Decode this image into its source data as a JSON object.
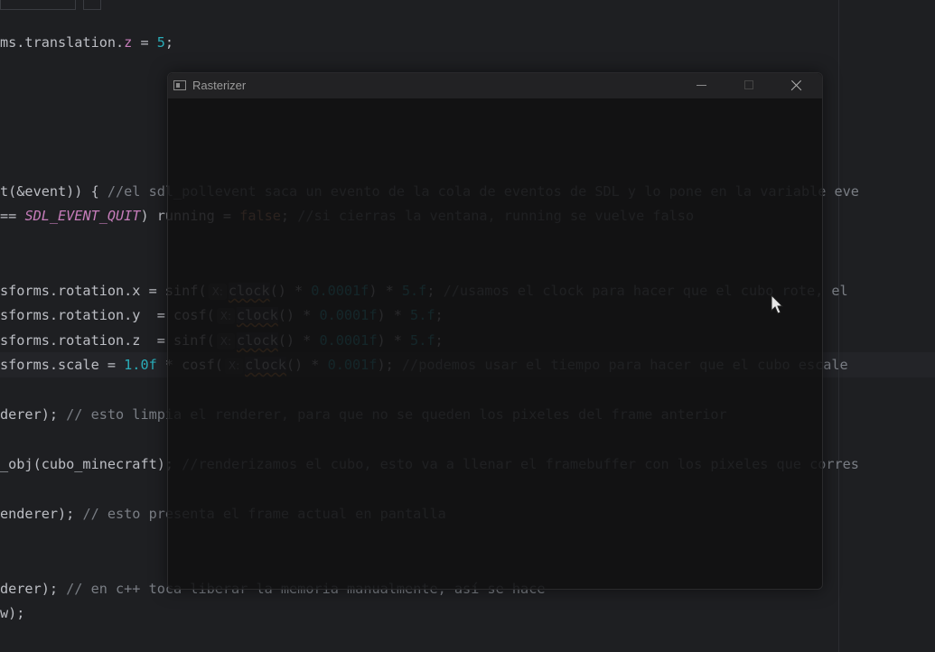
{
  "window": {
    "title": "Rasterizer"
  },
  "editor": {
    "lines": [
      {
        "segments": [
          {
            "t": "ms.translation.",
            "c": "plain"
          },
          {
            "t": "z",
            "c": "field"
          },
          {
            "t": " = ",
            "c": "plain"
          },
          {
            "t": "5",
            "c": "num"
          },
          {
            "t": ";",
            "c": "plain"
          }
        ]
      },
      {
        "segments": [
          {
            "t": "t(&event)) { ",
            "c": "plain"
          },
          {
            "t": "//el sdl_pollevent saca un evento de la cola de eventos de SDL y lo pone en la variable eve",
            "c": "com"
          }
        ]
      },
      {
        "segments": [
          {
            "t": "== ",
            "c": "plain"
          },
          {
            "t": "SDL_EVENT_QUIT",
            "c": "const"
          },
          {
            "t": ") running = ",
            "c": "plain"
          },
          {
            "t": "false",
            "c": "kw"
          },
          {
            "t": "; ",
            "c": "plain"
          },
          {
            "t": "//si cierras la ventana, running se vuelve falso",
            "c": "com"
          }
        ]
      },
      {
        "segments": [
          {
            "t": "sforms.rotation.x = sinf(",
            "c": "plain"
          },
          {
            "t": "X:",
            "c": "hint"
          },
          {
            "t": "clock",
            "c": "clock"
          },
          {
            "t": "() * ",
            "c": "plain"
          },
          {
            "t": "0.0001f",
            "c": "num"
          },
          {
            "t": ") * ",
            "c": "plain"
          },
          {
            "t": "5.f",
            "c": "num"
          },
          {
            "t": "; ",
            "c": "plain"
          },
          {
            "t": "//usamos el clock para hacer que el cubo rote, el",
            "c": "com"
          }
        ]
      },
      {
        "segments": [
          {
            "t": "sforms.rotation.y  = cosf(",
            "c": "plain"
          },
          {
            "t": "X:",
            "c": "hint"
          },
          {
            "t": "clock",
            "c": "clock"
          },
          {
            "t": "() * ",
            "c": "plain"
          },
          {
            "t": "0.0001f",
            "c": "num"
          },
          {
            "t": ") * ",
            "c": "plain"
          },
          {
            "t": "5.f",
            "c": "num"
          },
          {
            "t": ";",
            "c": "plain"
          }
        ]
      },
      {
        "segments": [
          {
            "t": "sforms.rotation.z  = sinf(",
            "c": "plain"
          },
          {
            "t": "X:",
            "c": "hint"
          },
          {
            "t": "clock",
            "c": "clock"
          },
          {
            "t": "() * ",
            "c": "plain"
          },
          {
            "t": "0.0001f",
            "c": "num"
          },
          {
            "t": ") * ",
            "c": "plain"
          },
          {
            "t": "5.f",
            "c": "num"
          },
          {
            "t": ";",
            "c": "plain"
          }
        ]
      },
      {
        "segments": [
          {
            "t": "sforms.scale = ",
            "c": "plain"
          },
          {
            "t": "1.0f",
            "c": "num"
          },
          {
            "t": " * cosf(",
            "c": "plain"
          },
          {
            "t": "X:",
            "c": "hint"
          },
          {
            "t": "clock",
            "c": "clock"
          },
          {
            "t": "() * ",
            "c": "plain"
          },
          {
            "t": "0.001f",
            "c": "num"
          },
          {
            "t": "); ",
            "c": "plain"
          },
          {
            "t": "//podemos usar el tiempo para hacer que el cubo escale",
            "c": "com"
          }
        ]
      },
      {
        "segments": [
          {
            "t": "derer); ",
            "c": "plain"
          },
          {
            "t": "// esto limpia el renderer, para que no se queden los pixeles del frame anterior",
            "c": "com"
          }
        ]
      },
      {
        "segments": [
          {
            "t": "_obj(cubo_minecraft); ",
            "c": "plain"
          },
          {
            "t": "//renderizamos el cubo, esto va a llenar el framebuffer con los pixeles que corres",
            "c": "com"
          }
        ]
      },
      {
        "segments": [
          {
            "t": "enderer); ",
            "c": "plain"
          },
          {
            "t": "// esto presenta el frame actual en pantalla",
            "c": "com"
          }
        ]
      },
      {
        "segments": [
          {
            "t": "derer); ",
            "c": "plain"
          },
          {
            "t": "// en c++ toca liberar la memoria manualmente, así se hace",
            "c": "com"
          }
        ]
      },
      {
        "segments": [
          {
            "t": "w);",
            "c": "plain"
          }
        ]
      }
    ]
  }
}
